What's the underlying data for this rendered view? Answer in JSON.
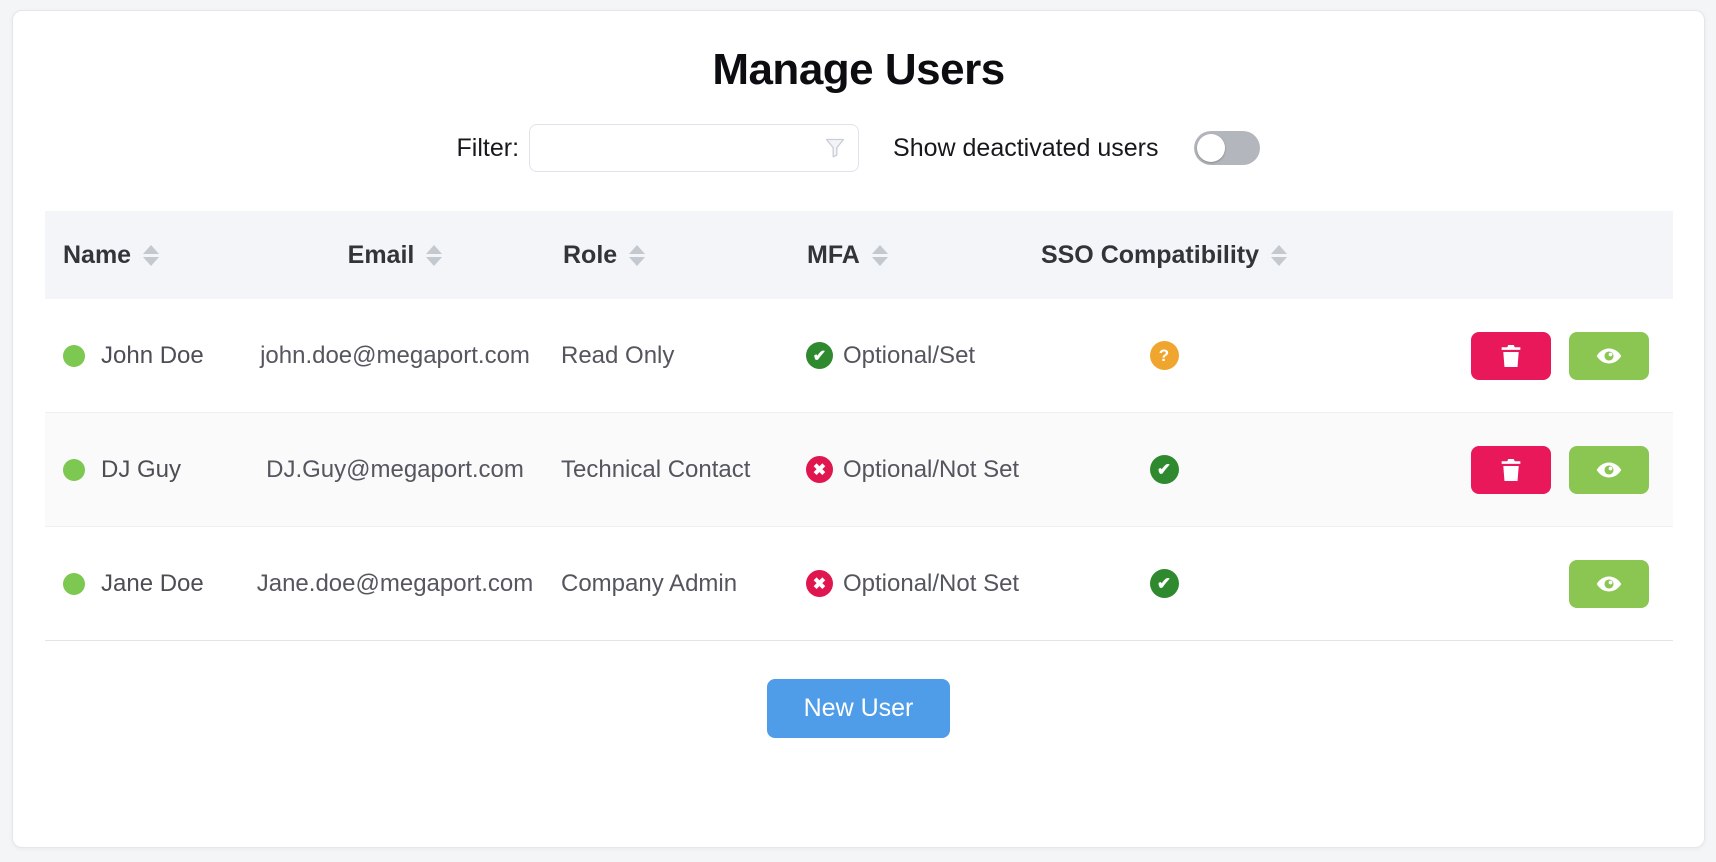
{
  "page": {
    "title": "Manage Users"
  },
  "filter": {
    "label": "Filter:",
    "input_value": "",
    "input_placeholder": "",
    "show_deactivated_label": "Show deactivated users",
    "show_deactivated_on": false
  },
  "glyphs": {
    "check": "✔",
    "cross": "✖",
    "question": "?"
  },
  "table": {
    "columns": [
      {
        "label": "Name",
        "sortable": true
      },
      {
        "label": "Email",
        "sortable": true
      },
      {
        "label": "Role",
        "sortable": true
      },
      {
        "label": "MFA",
        "sortable": true
      },
      {
        "label": "SSO Compatibility",
        "sortable": true
      }
    ],
    "rows": [
      {
        "status": "active",
        "name": "John Doe",
        "email": "john.doe@megaport.com",
        "role": "Read Only",
        "mfa_state": "set",
        "mfa_label": "Optional/Set",
        "sso_state": "unknown",
        "actions": [
          "delete",
          "view"
        ]
      },
      {
        "status": "active",
        "name": "DJ Guy",
        "email": "DJ.Guy@megaport.com",
        "role": "Technical Contact",
        "mfa_state": "not-set",
        "mfa_label": "Optional/Not Set",
        "sso_state": "compatible",
        "actions": [
          "delete",
          "view"
        ]
      },
      {
        "status": "active",
        "name": "Jane Doe",
        "email": "Jane.doe@megaport.com",
        "role": "Company Admin",
        "mfa_state": "not-set",
        "mfa_label": "Optional/Not Set",
        "sso_state": "compatible",
        "actions": [
          "view"
        ]
      }
    ]
  },
  "footer": {
    "new_user_label": "New User"
  },
  "icons": {
    "filter_icon": "funnel",
    "mfa_set": "check-circle-green",
    "mfa_not_set": "cross-circle-red",
    "sso_unknown": "question-circle-orange",
    "sso_compatible": "check-circle-green",
    "delete": "trash",
    "view": "eye",
    "sort": "up-down-triangles"
  },
  "colors": {
    "accent_blue": "#4f9ce8",
    "delete_pink": "#e8185b",
    "view_green": "#8bc652",
    "status_dot_green": "#7dc850",
    "mfa_set_green": "#2f8a2f",
    "mfa_not_set_red": "#e0164f",
    "sso_unknown_orange": "#f0a62e",
    "header_bg": "#f4f5f8",
    "page_bg": "#f4f5f7"
  }
}
